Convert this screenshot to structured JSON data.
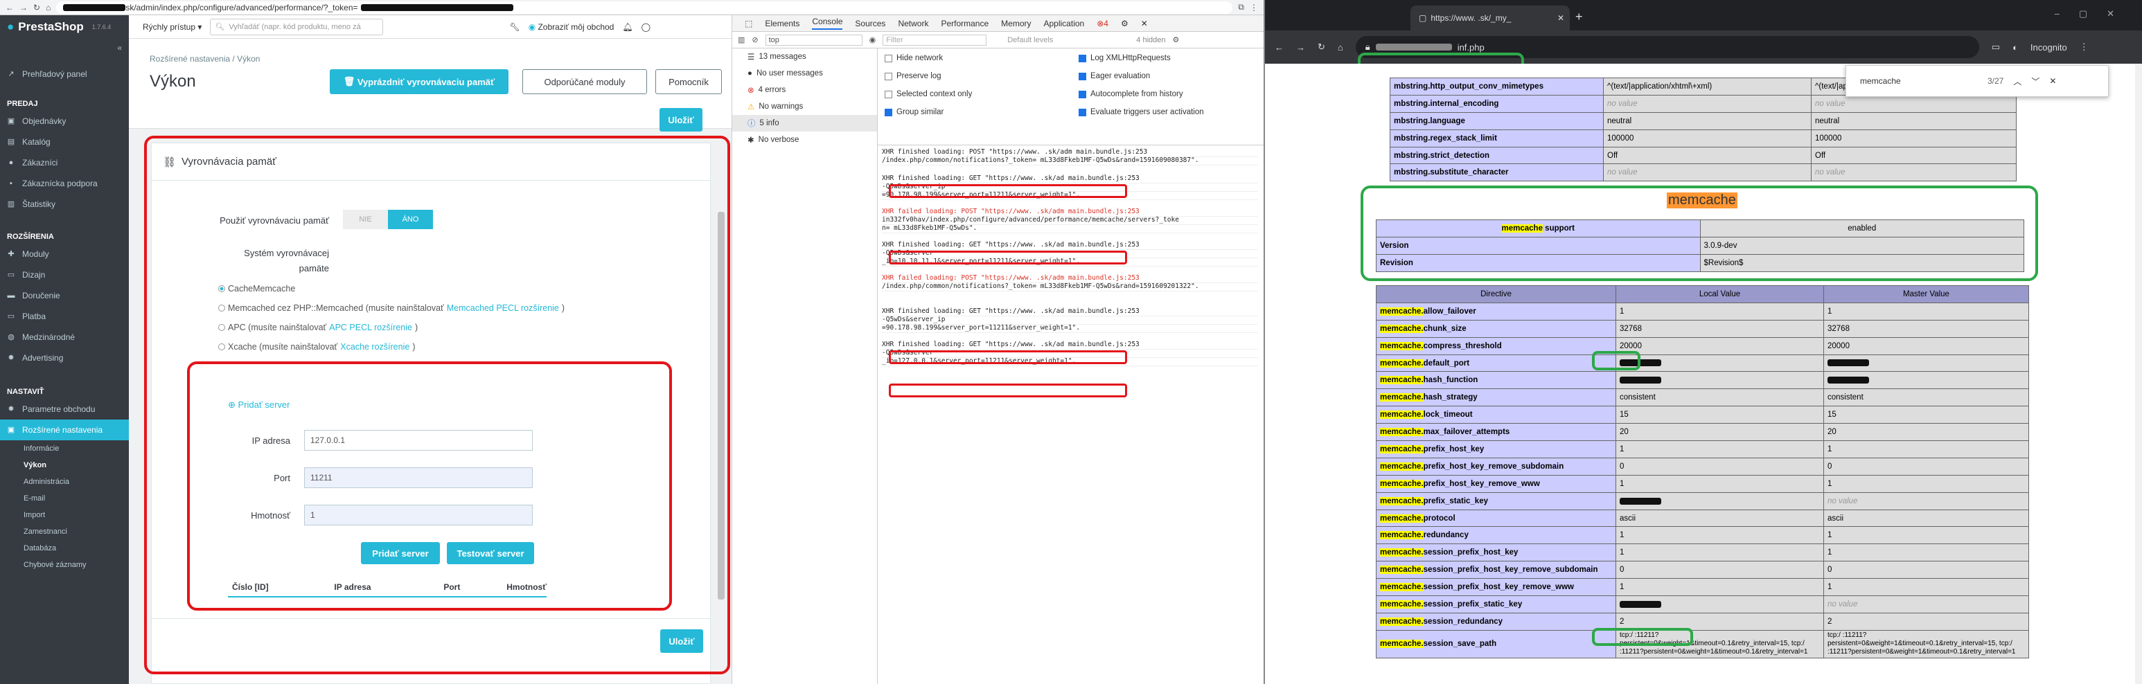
{
  "left_window": {
    "tab_count_icon": "3",
    "url": "sk/admin/index.php/configure/advanced/performance/?_token=",
    "ps_logo": "PrestaShop",
    "ps_version": "1.7.6.4",
    "quick_access": "Rýchly prístup",
    "search_placeholder": "Vyhľadáť (napr. kód produktu, meno zá",
    "show_store": "Zobraziť môj obchod",
    "breadcrumb": "Rozšírené nastavenia  /  Výkon",
    "page_title": "Výkon",
    "btn_clear_cache": "Vyprázdniť vyrovnávaciu pamäť",
    "btn_recommended": "Odporúčané moduly",
    "btn_help": "Pomocník",
    "btn_save": "Uložiť",
    "sidebar": {
      "dashboard": "Prehľadový panel",
      "sec_sell": "PREDAJ",
      "sell_items": [
        "Objednávky",
        "Katalóg",
        "Zákazníci",
        "Zákaznícka podpora",
        "Štatistiky"
      ],
      "sec_improve": "ROZŠÍRENIA",
      "improve_items": [
        "Moduly",
        "Dizajn",
        "Doručenie",
        "Platba",
        "Medzinárodné",
        "Advertising"
      ],
      "sec_configure": "NASTAVIŤ",
      "configure_items": [
        "Parametre obchodu",
        "Rozšírené nastavenia"
      ],
      "sub_items": [
        "Informácie",
        "Výkon",
        "Administrácia",
        "E-mail",
        "Import",
        "Zamestnanci",
        "Databáza",
        "Chybové záznamy"
      ]
    },
    "cache_panel": {
      "title": "Vyrovnávacia pamäť",
      "use_cache_label": "Použiť vyrovnávaciu pamäť",
      "no": "NIE",
      "yes": "ÁNO",
      "system_label": "Systém vyrovnávacej pamäte",
      "opt1": "CacheMemcache",
      "opt2_pre": "Memcached cez PHP::Memcached (musíte nainštalovať ",
      "opt2_link": "Memcached PECL rozšírenie",
      "opt3_pre": "APC (musíte nainštalovať ",
      "opt3_link": "APC PECL rozšírenie",
      "opt4_pre": "Xcache (musíte nainštalovať ",
      "opt4_link": "Xcache rozšírenie",
      "add_server": "Pridať server",
      "ip_label": "IP adresa",
      "ip_value": "127.0.0.1",
      "port_label": "Port",
      "port_value": "11211",
      "weight_label": "Hmotnosť",
      "weight_value": "1",
      "btn_add": "Pridať server",
      "btn_test": "Testovať server",
      "col_id": "Číslo [ID]",
      "col_ip": "IP adresa",
      "col_port": "Port",
      "col_weight": "Hmotnosť"
    },
    "devtools": {
      "tabs": [
        "Elements",
        "Console",
        "Sources",
        "Network",
        "Performance",
        "Memory",
        "Application"
      ],
      "errors_badge": "4",
      "context": "top",
      "filter_placeholder": "Filter",
      "levels": "Default levels",
      "hidden": "4 hidden",
      "left": [
        "13 messages",
        "No user messages",
        "4 errors",
        "No warnings",
        "5 info",
        "No verbose"
      ],
      "opts_left": [
        "Hide network",
        "Preserve log",
        "Selected context only",
        "Group similar"
      ],
      "opts_right": [
        "Log XMLHttpRequests",
        "Eager evaluation",
        "Autocomplete from history",
        "Evaluate triggers user activation"
      ],
      "log": [
        "XHR finished loading: POST \"https://www.       .sk/adm  main.bundle.js:253",
        "/index.php/common/notifications?_token=          mL33d8Fkeb1MF-Q5wDs&rand=1591609080387\".",
        "XHR finished loading: GET \"https://www.       .sk/ad  main.bundle.js:253",
        "                                  -Q5wDs&server_ip",
        "=90.178.98.199&server_port=11211&server_weight=1\".",
        "XHR failed loading: POST \"https://www.       .sk/adm  main.bundle.js:253",
        "in332fv0hav/index.php/configure/advanced/performance/memcache/servers?_toke",
        "n=          mL33d8Fkeb1MF-Q5wDs\".",
        "XHR finished loading: GET \"https://www.       .sk/ad  main.bundle.js:253",
        "                                  -Q5wDs&server",
        "_ip=10.10.11.1&server_port=11211&server_weight=1\".",
        "XHR failed loading: POST \"https://www.       .sk/adm  main.bundle.js:253",
        "          /index.php/common/notifications?_token=          mL33d8Fkeb1MF-Q5wDs&rand=1591609201322\".",
        "XHR finished loading: GET \"https://www.       .sk/ad  main.bundle.js:253",
        "                                  -Q5wDs&server_ip",
        "=90.178.98.199&server_port=11211&server_weight=1\".",
        "XHR finished loading: GET \"https://www.       .sk/ad  main.bundle.js:253",
        "                                  -Q5wDs&server",
        "_ip=127.0.0.1&server_port=11211&server_weight=1\"."
      ]
    }
  },
  "right_window": {
    "tab_url": "https://www.       .sk/_my_",
    "url_suffix": "inf.php",
    "incognito": "Incognito",
    "find_query": "memcache",
    "find_count": "3/27",
    "mbstring_rows": [
      [
        "mbstring.http_output_conv_mimetypes",
        "^(text/|application/xhtml\\+xml)",
        "^(text/|application/xhtml\\+xml)"
      ],
      [
        "mbstring.internal_encoding",
        "no value",
        "no value"
      ],
      [
        "mbstring.language",
        "neutral",
        "neutral"
      ],
      [
        "mbstring.regex_stack_limit",
        "100000",
        "100000"
      ],
      [
        "mbstring.strict_detection",
        "Off",
        "Off"
      ],
      [
        "mbstring.substitute_character",
        "no value",
        "no value"
      ]
    ],
    "section_title": "memcache",
    "support_label": "memcache support",
    "support_value": "enabled",
    "version_label": "Version",
    "version_value": "3.0.9-dev",
    "revision_label": "Revision",
    "revision_value": "$Revision$",
    "col_directive": "Directive",
    "col_local": "Local Value",
    "col_master": "Master Value",
    "directives": [
      [
        "allow_failover",
        "1",
        "1"
      ],
      [
        "chunk_size",
        "32768",
        "32768"
      ],
      [
        "compress_threshold",
        "20000",
        "20000"
      ],
      [
        "default_port",
        "",
        ""
      ],
      [
        "hash_function",
        "",
        ""
      ],
      [
        "hash_strategy",
        "consistent",
        "consistent"
      ],
      [
        "lock_timeout",
        "15",
        "15"
      ],
      [
        "max_failover_attempts",
        "20",
        "20"
      ],
      [
        "prefix_host_key",
        "1",
        "1"
      ],
      [
        "prefix_host_key_remove_subdomain",
        "0",
        "0"
      ],
      [
        "prefix_host_key_remove_www",
        "1",
        "1"
      ],
      [
        "prefix_static_key",
        "",
        "no value"
      ],
      [
        "protocol",
        "ascii",
        "ascii"
      ],
      [
        "redundancy",
        "1",
        "1"
      ],
      [
        "session_prefix_host_key",
        "1",
        "1"
      ],
      [
        "session_prefix_host_key_remove_subdomain",
        "0",
        "0"
      ],
      [
        "session_prefix_host_key_remove_www",
        "1",
        "1"
      ],
      [
        "session_prefix_static_key",
        "",
        "no value"
      ],
      [
        "session_redundancy",
        "2",
        "2"
      ],
      [
        "session_save_path",
        "tcp:/     :11211?persistent=0&weight=1&timeout=0.1&retry_interval=15, tcp:/     :11211?persistent=0&weight=1&timeout=0.1&retry_interval=1",
        "tcp:/     :11211?persistent=0&weight=1&timeout=0.1&retry_interval=15, tcp:/     :11211?persistent=0&weight=1&timeout=0.1&retry_interval=1"
      ]
    ],
    "prefix": "memcache."
  },
  "colors": {
    "ps_blue": "#25b9d7",
    "ps_sidebar": "#363a41",
    "highlight_red": "#e3151a",
    "highlight_green": "#2da84a",
    "find_yellow": "#ffff00",
    "php_header": "#9999cc"
  }
}
